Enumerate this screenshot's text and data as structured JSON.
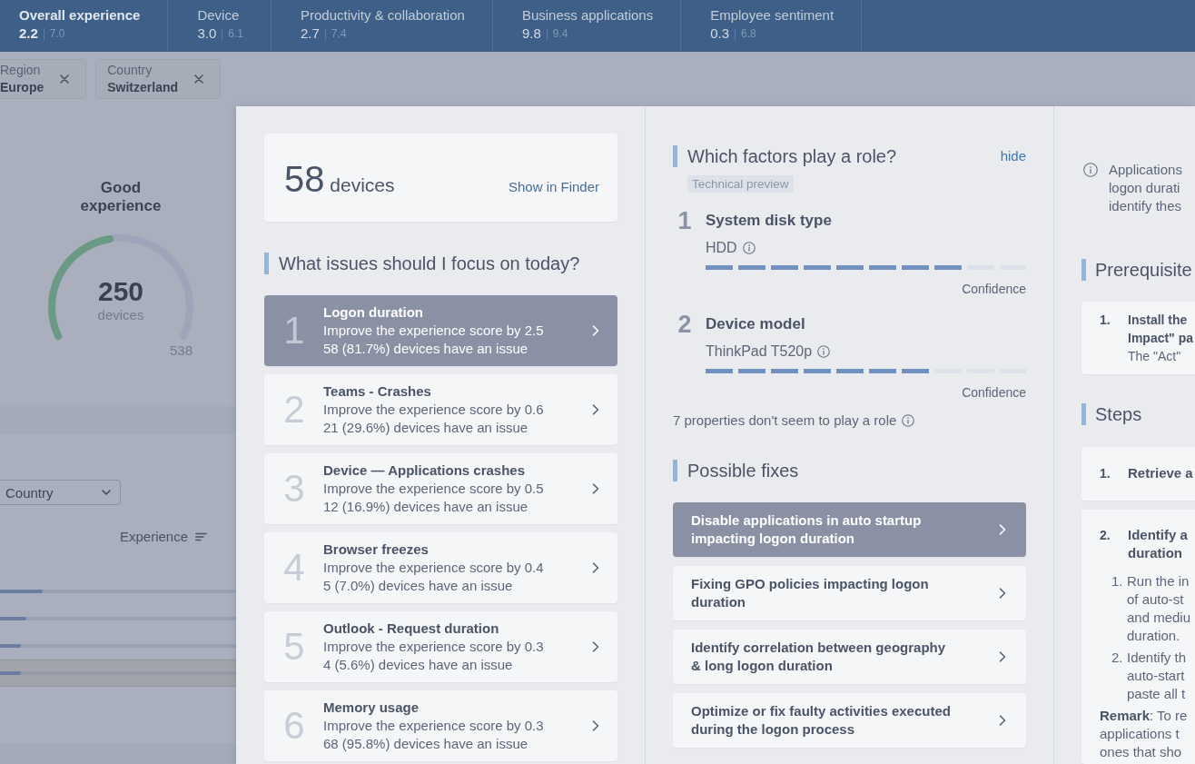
{
  "top_tabs": [
    {
      "label": "Overall experience",
      "score": "2.2",
      "benchmark": "7.0",
      "selected": true
    },
    {
      "label": "Device",
      "score": "3.0",
      "benchmark": "6.1",
      "selected": false
    },
    {
      "label": "Productivity & collaboration",
      "score": "2.7",
      "benchmark": "7.4",
      "selected": false
    },
    {
      "label": "Business applications",
      "score": "9.8",
      "benchmark": "9.4",
      "selected": false
    },
    {
      "label": "Employee sentiment",
      "score": "0.3",
      "benchmark": "6.8",
      "selected": false
    }
  ],
  "filters": [
    {
      "label": "Region",
      "value": "Europe"
    },
    {
      "label": "Country",
      "value": "Switzerland"
    }
  ],
  "overview": {
    "title": "Good experience",
    "gauge": {
      "level": 0.46,
      "value": "250",
      "unit": "devices",
      "max": "538"
    }
  },
  "breakdown": {
    "group_by": "Country",
    "sort_label": "Experience",
    "rows": [
      {
        "level": 0.18,
        "selected": false
      },
      {
        "level": 0.11,
        "selected": false
      },
      {
        "level": 0.09,
        "selected": false
      },
      {
        "level": 0.09,
        "selected": true
      }
    ]
  },
  "issues_panel": {
    "device_count": "58",
    "device_unit": "devices",
    "finder_link": "Show in Finder",
    "heading": "What issues should I focus on today?",
    "issues": [
      {
        "rank": "1",
        "title": "Logon duration",
        "impact": "Improve the experience score by 2.5",
        "affected": "58 (81.7%) devices have an issue",
        "selected": true
      },
      {
        "rank": "2",
        "title": "Teams - Crashes",
        "impact": "Improve the experience score by 0.6",
        "affected": "21 (29.6%) devices have an issue",
        "selected": false
      },
      {
        "rank": "3",
        "title": "Device — Applications crashes",
        "impact": "Improve the experience score by 0.5",
        "affected": "12 (16.9%) devices have an issue",
        "selected": false
      },
      {
        "rank": "4",
        "title": "Browser freezes",
        "impact": "Improve the experience score by 0.4",
        "affected": "5 (7.0%) devices have an issue",
        "selected": false
      },
      {
        "rank": "5",
        "title": "Outlook - Request duration",
        "impact": "Improve the experience score by 0.3",
        "affected": "4 (5.6%) devices have an issue",
        "selected": false
      },
      {
        "rank": "6",
        "title": "Memory usage",
        "impact": "Improve the experience score by 0.3",
        "affected": "68 (95.8%) devices have an issue",
        "selected": false
      }
    ]
  },
  "factors_panel": {
    "heading": "Which factors play a role?",
    "hide_link": "hide",
    "badge": "Technical preview",
    "factors": [
      {
        "rank": "1",
        "name": "System disk type",
        "value": "HDD",
        "level": 0.8,
        "confidence_label": "Confidence"
      },
      {
        "rank": "2",
        "name": "Device model",
        "value": "ThinkPad T520p",
        "level": 0.7,
        "confidence_label": "Confidence"
      }
    ],
    "note": "7 properties don't seem to play a role",
    "fixes_heading": "Possible fixes",
    "fixes": [
      {
        "title": "Disable applications in auto startup impacting logon duration",
        "selected": true
      },
      {
        "title": "Fixing GPO policies impacting logon duration",
        "selected": false
      },
      {
        "title": "Identify correlation between geography & long logon duration",
        "selected": false
      },
      {
        "title": "Optimize or fix faulty activities executed during the logon process",
        "selected": false
      }
    ]
  },
  "fix_detail": {
    "info_lines": [
      "Applications",
      "logon durati",
      "identify thes"
    ],
    "prerequisites_heading": "Prerequisite",
    "prerequisites": [
      {
        "number": "1.",
        "title_lines": [
          "Install the",
          "Impact\" pa"
        ],
        "text_lines": [
          "The \"Act\""
        ]
      }
    ],
    "steps_heading": "Steps",
    "steps": [
      {
        "number": "1.",
        "title_lines": [
          "Retrieve a"
        ]
      },
      {
        "number": "2.",
        "title_lines": [
          "Identify a",
          "duration"
        ],
        "substeps": [
          {
            "number": "1.",
            "lines": [
              "Run the in",
              "of auto-st",
              "and mediu",
              "duration."
            ]
          },
          {
            "number": "2.",
            "lines": [
              "Identify th",
              "auto-start",
              "paste all t"
            ]
          }
        ],
        "remark_lines": [
          "**Remark**: To re",
          "applications t",
          "ones that sho"
        ]
      }
    ]
  }
}
